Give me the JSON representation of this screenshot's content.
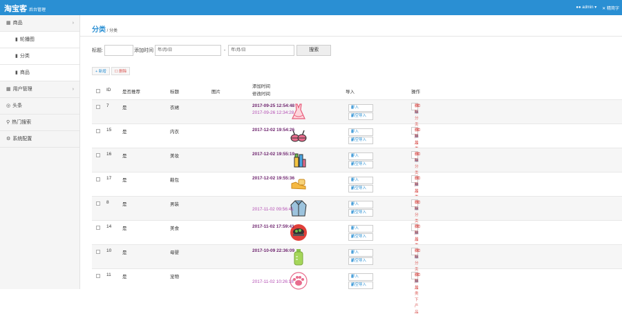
{
  "header": {
    "brand": "淘宝客",
    "brand_sub": "后台管理",
    "user": "admin ▾",
    "right_link": "精简字"
  },
  "sidebar": {
    "items": [
      {
        "icon": "grid-icon",
        "label": "商品",
        "caret": "›"
      },
      {
        "icon": "file-icon",
        "label": "轮播图"
      },
      {
        "icon": "file-icon",
        "label": "分类"
      },
      {
        "icon": "file-icon",
        "label": "商品"
      },
      {
        "icon": "grid-icon",
        "label": "用户管理",
        "caret": "›"
      },
      {
        "icon": "target-icon",
        "label": "头条"
      },
      {
        "icon": "search-icon",
        "label": "热门搜索"
      },
      {
        "icon": "gear-icon",
        "label": "系统配置"
      }
    ]
  },
  "breadcrumb": {
    "title": "分类",
    "sep": " / ",
    "current": "分类"
  },
  "filters": {
    "title_label": "标题:",
    "time_label": "添加时间",
    "date_from": "年/月/日",
    "sep": "-",
    "date_to": "年/月/日",
    "search_btn": "搜索"
  },
  "toolbar": {
    "add": "+ 新增",
    "del": "☐ 删除"
  },
  "table": {
    "headers": {
      "id": "ID",
      "recommend": "是否推荐",
      "title": "标题",
      "image": "图片",
      "time_a": "添加时间",
      "time_b": "修改时间",
      "import": "导入",
      "ops": "操作"
    },
    "rows": [
      {
        "id": "7",
        "rec": "是",
        "title": "衣裙",
        "t1": "2017-09-25 12:54:48",
        "t2": "2017-09-26 12:34:28",
        "icon": "dress-icon"
      },
      {
        "id": "15",
        "rec": "是",
        "title": "内衣",
        "t1": "2017-12-02 19:54:26",
        "t2": "",
        "icon": "bra-icon"
      },
      {
        "id": "16",
        "rec": "是",
        "title": "美妆",
        "t1": "2017-12-02 19:55:19",
        "t2": "",
        "icon": "cosmetics-icon"
      },
      {
        "id": "17",
        "rec": "是",
        "title": "鞋包",
        "t1": "2017-12-02 19:55:36",
        "t2": "",
        "icon": "shoes-icon"
      },
      {
        "id": "8",
        "rec": "是",
        "title": "男装",
        "t1": "",
        "t2": "2017-11-02 09:56:41",
        "icon": "jacket-icon"
      },
      {
        "id": "14",
        "rec": "是",
        "title": "美食",
        "t1": "2017-11-02 17:59:41",
        "t2": "",
        "icon": "food-icon"
      },
      {
        "id": "10",
        "rec": "是",
        "title": "母婴",
        "t1": "2017-10-09 22:36:09",
        "t2": "",
        "icon": "bottle-icon"
      },
      {
        "id": "11",
        "rec": "是",
        "title": "宠物",
        "t1": "",
        "t2": "2017-11-02 10:26:18",
        "icon": "paw-icon"
      }
    ],
    "row_import": [
      "导入",
      "清空导入"
    ],
    "row_ops": [
      "编辑",
      "同级",
      "删除",
      "删除分类下产品"
    ]
  },
  "colors": {
    "accent": "#2a8fd3",
    "date_dark": "#6b1f6b",
    "date_light": "#b24bb2",
    "danger": "#d9534f"
  }
}
